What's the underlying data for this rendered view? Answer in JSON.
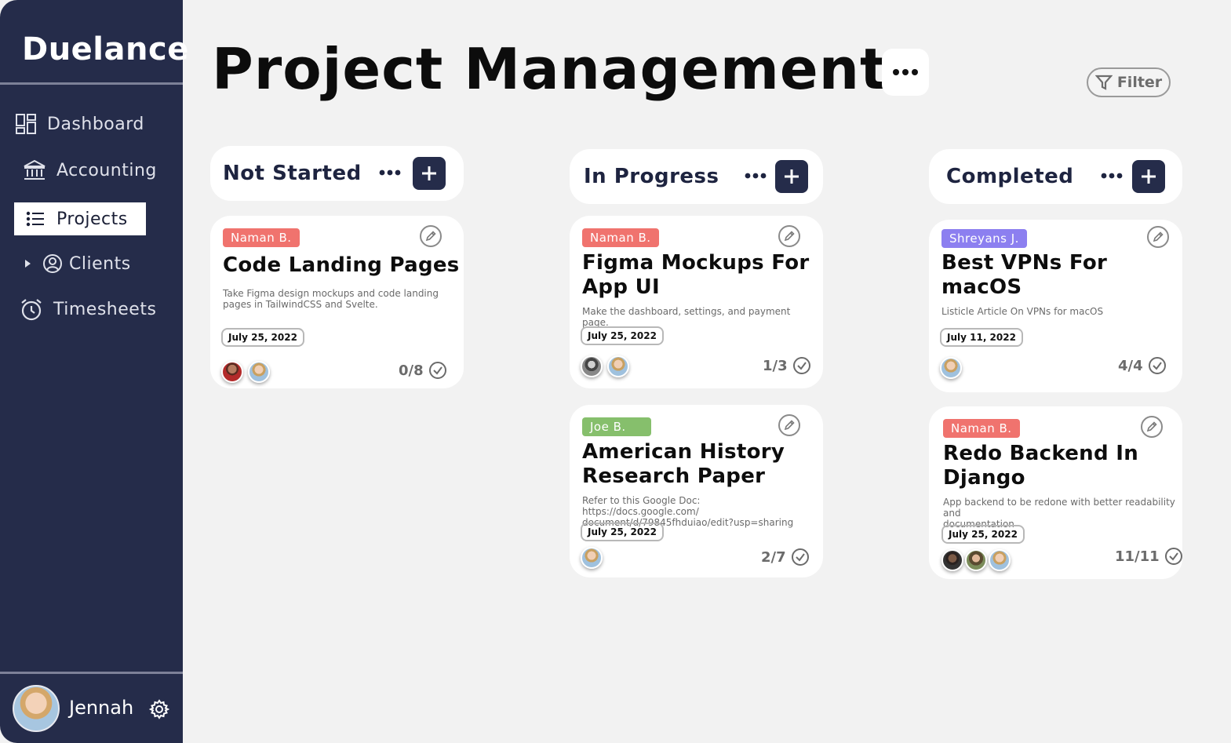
{
  "app": {
    "name": "Duelance"
  },
  "sidebar": {
    "items": [
      {
        "label": "Dashboard",
        "icon": "dashboard-icon"
      },
      {
        "label": "Accounting",
        "icon": "bank-icon"
      },
      {
        "label": "Projects",
        "icon": "list-icon",
        "active": true
      },
      {
        "label": "Clients",
        "icon": "user-circle-icon",
        "collapsible": true
      },
      {
        "label": "Timesheets",
        "icon": "alarm-clock-icon"
      }
    ],
    "user": {
      "name": "Jennah"
    }
  },
  "header": {
    "title": "Project Management",
    "filter_label": "Filter"
  },
  "colors": {
    "sidebar_bg": "#252c4a",
    "tag_red": "#f0736e",
    "tag_purple": "#8c7ff0",
    "tag_green": "#86bf6c"
  },
  "columns": [
    {
      "title": "Not Started",
      "cards": [
        {
          "assignee": "Naman B.",
          "tag_color": "#f0736e",
          "title_lines": [
            "Code Landing Pages"
          ],
          "description_lines": [
            "Take Figma design mockups and code landing",
            "pages in TailwindCSS and Svelte."
          ],
          "date": "July 25, 2022",
          "progress": "0/8",
          "avatars": [
            "red",
            "blonde"
          ]
        }
      ]
    },
    {
      "title": "In Progress",
      "cards": [
        {
          "assignee": "Naman B.",
          "tag_color": "#f0736e",
          "title_lines": [
            "Figma Mockups For",
            "App UI"
          ],
          "description_lines": [
            "Make the dashboard, settings, and payment page."
          ],
          "date": "July 25, 2022",
          "progress": "1/3",
          "avatars": [
            "bw",
            "blonde"
          ]
        },
        {
          "assignee": "Joe B.",
          "tag_color": "#86bf6c",
          "title_lines": [
            "American History",
            "Research Paper"
          ],
          "description_lines": [
            "Refer to this Google Doc: https://docs.google.com/",
            "document/d/79845fhduiao/edit?usp=sharing"
          ],
          "date": "July 25, 2022",
          "progress": "2/7",
          "avatars": [
            "blonde"
          ]
        }
      ]
    },
    {
      "title": "Completed",
      "cards": [
        {
          "assignee": "Shreyans J.",
          "tag_color": "#8c7ff0",
          "title_lines": [
            "Best VPNs For",
            "macOS"
          ],
          "description_lines": [
            "Listicle Article On VPNs for macOS"
          ],
          "date": "July 11, 2022",
          "progress": "4/4",
          "avatars": [
            "blonde"
          ]
        },
        {
          "assignee": "Naman B.",
          "tag_color": "#f0736e",
          "title_lines": [
            "Redo Backend In",
            "Django"
          ],
          "description_lines": [
            "App backend to be redone with better readability and",
            "documentation"
          ],
          "date": "July 25, 2022",
          "progress": "11/11",
          "avatars": [
            "dark",
            "curly",
            "blonde"
          ]
        }
      ]
    }
  ]
}
